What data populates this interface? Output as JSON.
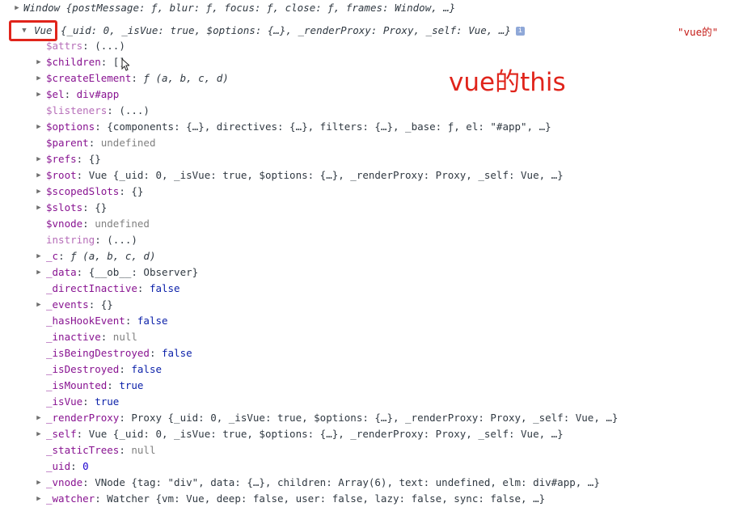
{
  "top": {
    "text": "Window {postMessage: ƒ, blur: ƒ, focus: ƒ, close: ƒ, frames: Window, …}"
  },
  "vue": {
    "label": "Vue",
    "summary": "{_uid: 0, _isVue: true, $options: {…}, _renderProxy: Proxy, _self: Vue, …}",
    "side_string": "\"vue的\"",
    "info_icon": "i"
  },
  "annotation": "vue的this",
  "props": [
    {
      "key": "$attrs",
      "value": "(...)",
      "vclass": "",
      "expandable": false,
      "dim": true
    },
    {
      "key": "$children",
      "value": "[]",
      "vclass": "",
      "expandable": true,
      "dim": false
    },
    {
      "key": "$createElement",
      "value": "ƒ (a, b, c, d)",
      "vclass": "italic",
      "expandable": true,
      "dim": false
    },
    {
      "key": "$el",
      "value": "div#app",
      "vclass": "key",
      "expandable": true,
      "dim": false
    },
    {
      "key": "$listeners",
      "value": "(...)",
      "vclass": "",
      "expandable": false,
      "dim": true
    },
    {
      "key": "$options",
      "value": "{components: {…}, directives: {…}, filters: {…}, _base: ƒ, el: \"#app\", …}",
      "vclass": "",
      "expandable": true,
      "dim": false
    },
    {
      "key": "$parent",
      "value": "undefined",
      "vclass": "undef",
      "expandable": false,
      "dim": false
    },
    {
      "key": "$refs",
      "value": "{}",
      "vclass": "",
      "expandable": true,
      "dim": false
    },
    {
      "key": "$root",
      "value": "Vue {_uid: 0, _isVue: true, $options: {…}, _renderProxy: Proxy, _self: Vue, …}",
      "vclass": "",
      "expandable": true,
      "dim": false
    },
    {
      "key": "$scopedSlots",
      "value": "{}",
      "vclass": "",
      "expandable": true,
      "dim": false
    },
    {
      "key": "$slots",
      "value": "{}",
      "vclass": "",
      "expandable": true,
      "dim": false
    },
    {
      "key": "$vnode",
      "value": "undefined",
      "vclass": "undef",
      "expandable": false,
      "dim": false
    },
    {
      "key": "instring",
      "value": "(...)",
      "vclass": "",
      "expandable": false,
      "dim": true
    },
    {
      "key": "_c",
      "value": "ƒ (a, b, c, d)",
      "vclass": "italic",
      "expandable": true,
      "dim": false
    },
    {
      "key": "_data",
      "value": "{__ob__: Observer}",
      "vclass": "",
      "expandable": true,
      "dim": false
    },
    {
      "key": "_directInactive",
      "value": "false",
      "vclass": "bool",
      "expandable": false,
      "dim": false
    },
    {
      "key": "_events",
      "value": "{}",
      "vclass": "",
      "expandable": true,
      "dim": false
    },
    {
      "key": "_hasHookEvent",
      "value": "false",
      "vclass": "bool",
      "expandable": false,
      "dim": false
    },
    {
      "key": "_inactive",
      "value": "null",
      "vclass": "undef",
      "expandable": false,
      "dim": false
    },
    {
      "key": "_isBeingDestroyed",
      "value": "false",
      "vclass": "bool",
      "expandable": false,
      "dim": false
    },
    {
      "key": "_isDestroyed",
      "value": "false",
      "vclass": "bool",
      "expandable": false,
      "dim": false
    },
    {
      "key": "_isMounted",
      "value": "true",
      "vclass": "bool",
      "expandable": false,
      "dim": false
    },
    {
      "key": "_isVue",
      "value": "true",
      "vclass": "bool",
      "expandable": false,
      "dim": false
    },
    {
      "key": "_renderProxy",
      "value": "Proxy {_uid: 0, _isVue: true, $options: {…}, _renderProxy: Proxy, _self: Vue, …}",
      "vclass": "",
      "expandable": true,
      "dim": false
    },
    {
      "key": "_self",
      "value": "Vue {_uid: 0, _isVue: true, $options: {…}, _renderProxy: Proxy, _self: Vue, …}",
      "vclass": "",
      "expandable": true,
      "dim": false
    },
    {
      "key": "_staticTrees",
      "value": "null",
      "vclass": "undef",
      "expandable": false,
      "dim": false
    },
    {
      "key": "_uid",
      "value": "0",
      "vclass": "num",
      "expandable": false,
      "dim": false
    },
    {
      "key": "_vnode",
      "value": "VNode {tag: \"div\", data: {…}, children: Array(6), text: undefined, elm: div#app, …}",
      "vclass": "",
      "expandable": true,
      "dim": false
    },
    {
      "key": "_watcher",
      "value": "Watcher {vm: Vue, deep: false, user: false, lazy: false, sync: false, …}",
      "vclass": "",
      "expandable": true,
      "dim": false
    }
  ]
}
